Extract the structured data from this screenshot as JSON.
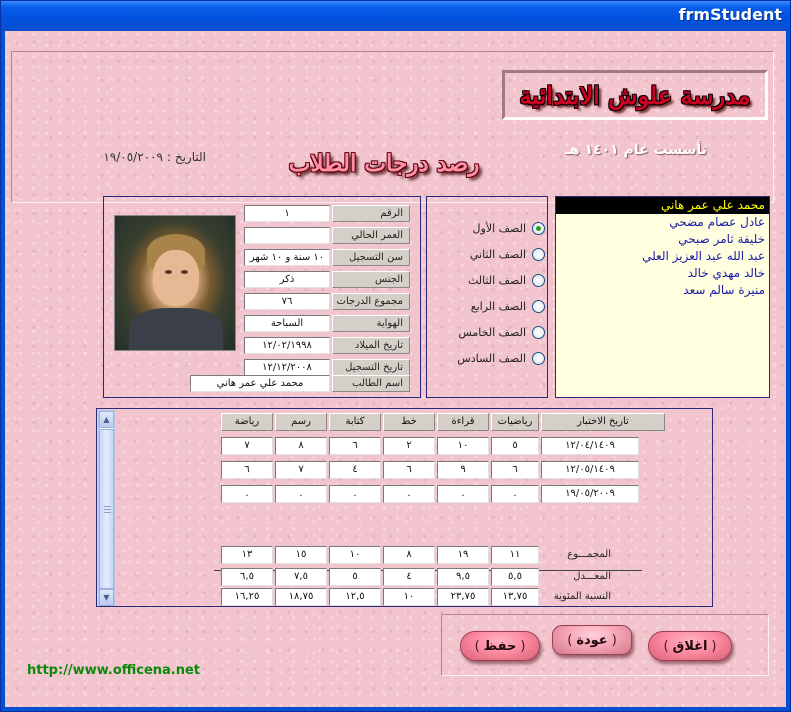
{
  "window": {
    "title": "frmStudent"
  },
  "header": {
    "school_name": "مدرسة علوش الابتدائية",
    "founded": "تأسست عام  ١٤٠١ هـ",
    "grades_title": "رصد درجات الطلاب",
    "date_label": "التاريخ :",
    "date_value": "١٩/٠٥/٢٠٠٩"
  },
  "students": {
    "items": [
      "محمد علي عمر هاني",
      "عادل عصام مضحي",
      "خليفة ثامر صبحي",
      "عبد الله عبد العزيز العلي",
      "خالد مهدي خالد",
      "منيرة سالم سعد"
    ],
    "selected_index": 0
  },
  "grades": {
    "options": [
      "الصف الأول",
      "الصف الثاني",
      "الصف الثالث",
      "الصف الرابع",
      "الصف الخامس",
      "الصف السادس"
    ],
    "selected_index": 0
  },
  "student_info": {
    "fields": [
      {
        "label": "الرقم",
        "value": "١"
      },
      {
        "label": "العمر الحالي",
        "value": ""
      },
      {
        "label": "سن التسجيل",
        "value": "١٠ سنة و ١٠ شهر"
      },
      {
        "label": "الجنس",
        "value": "ذكر"
      },
      {
        "label": "مجموع الدرجات",
        "value": "٧٦"
      },
      {
        "label": "الهواية",
        "value": "السباحة"
      },
      {
        "label": "تاريخ الميلاد",
        "value": "١٢/٠٢/١٩٩٨"
      },
      {
        "label": "تاريخ التسجيل",
        "value": "١٢/١٢/٢٠٠٨"
      },
      {
        "label": "اسم الطالب",
        "value": "محمد علي عمر هاني"
      }
    ]
  },
  "grades_table": {
    "headers": [
      "تاريخ الاختبار",
      "رياضيات",
      "قراءة",
      "خط",
      "كتابة",
      "رسم",
      "رياضة"
    ],
    "rows": [
      [
        "١٢/٠٤/١٤٠٩",
        "٥",
        "١٠",
        "٢",
        "٦",
        "٨",
        "٧"
      ],
      [
        "١٢/٠٥/١٤٠٩",
        "٦",
        "٩",
        "٦",
        "٤",
        "٧",
        "٦"
      ],
      [
        "١٩/٠٥/٢٠٠٩",
        ".",
        ".",
        ".",
        ".",
        ".",
        "."
      ]
    ],
    "summary": [
      {
        "label": "المجمـــوع",
        "values": [
          "١١",
          "١٩",
          "٨",
          "١٠",
          "١٥",
          "١٣"
        ]
      },
      {
        "label": "المعـــدل",
        "values": [
          "٥,٥",
          "٩,٥",
          "٤",
          "٥",
          "٧,٥",
          "٦,٥"
        ]
      },
      {
        "label": "النسبة المئوية",
        "values": [
          "١٣,٧٥",
          "٢٣,٧٥",
          "١٠",
          "١٢,٥",
          "١٨,٧٥",
          "١٦,٢٥"
        ]
      }
    ]
  },
  "buttons": {
    "close_label": "اغلاق",
    "back_label": "عودة",
    "save_label": "حفظ",
    "paren_open": "(",
    "paren_close": ")"
  },
  "footer": {
    "url": "http://www.officena.net"
  },
  "colors": {
    "titlebar": "#0a4fd1",
    "background": "#f2c4ce",
    "accent": "#ff8fa4",
    "selected": "#ffff00"
  }
}
